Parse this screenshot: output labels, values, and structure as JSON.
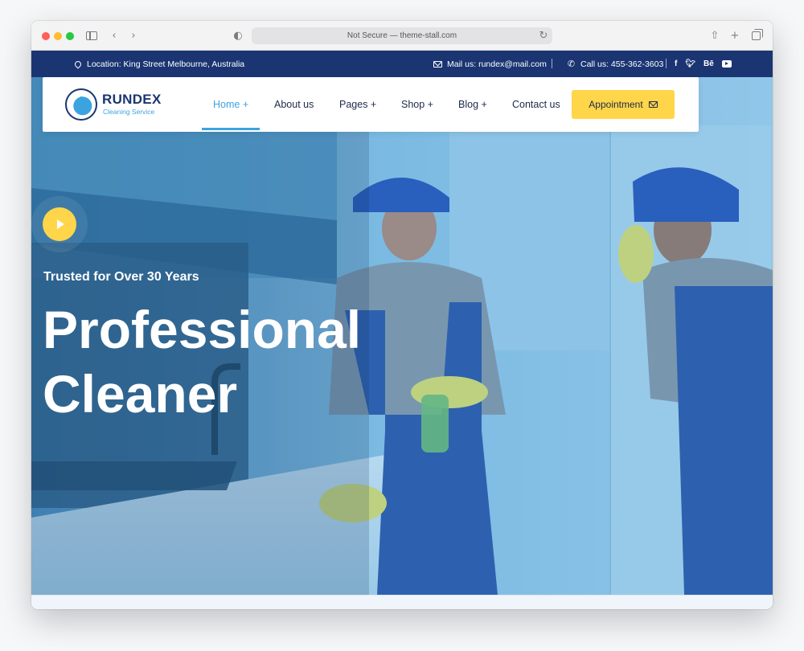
{
  "browser": {
    "url_text": "Not Secure — theme-stall.com",
    "icons": [
      "sidebar-icon",
      "back-icon",
      "forward-icon",
      "shield-icon",
      "reload-icon",
      "share-icon",
      "new-tab-icon",
      "tabs-overview-icon"
    ]
  },
  "topbar": {
    "location": "Location: King Street Melbourne, Australia",
    "mail": "Mail us: rundex@mail.com",
    "call": "Call us: 455-362-3603",
    "socials": {
      "facebook": "f",
      "twitter": "t",
      "behance": "Bē",
      "youtube": "youtube"
    }
  },
  "brand": {
    "name": "RUNDEX",
    "tagline": "Cleaning Service"
  },
  "nav": {
    "items": [
      {
        "label": "Home +"
      },
      {
        "label": "About us"
      },
      {
        "label": "Pages +"
      },
      {
        "label": "Shop +"
      },
      {
        "label": "Blog +"
      },
      {
        "label": "Contact us"
      }
    ],
    "active": "Home +",
    "cta_label": "Appointment"
  },
  "hero": {
    "eyebrow": "Trusted for Over 30 Years",
    "headline_line1": "Professional",
    "headline_line2": "Cleaner"
  },
  "colors": {
    "topbar_bg": "#1b3572",
    "accent_blue": "#3aa3e0",
    "cta_yellow": "#ffd54a",
    "brand_navy": "#1b3572"
  }
}
